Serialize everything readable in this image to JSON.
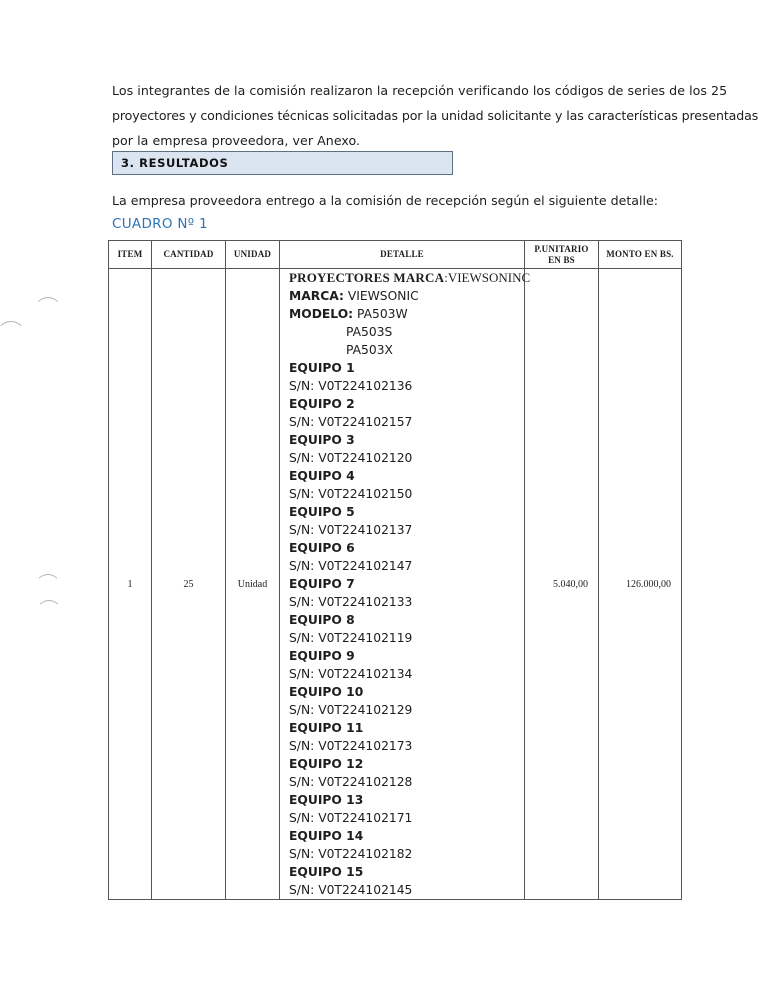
{
  "intro": {
    "line1": "Los integrantes de la comisión realizaron la recepción verificando los códigos de series de los 25",
    "line2": "proyectores  y condiciones técnicas solicitadas por la unidad solicitante y las características presentadas",
    "line3": "por la empresa proveedora, ver Anexo."
  },
  "section": {
    "heading": "3.  RESULTADOS"
  },
  "description": "La empresa proveedora entrego a la comisión de recepción según el siguiente detalle:",
  "table_title": "CUADRO Nº 1",
  "table": {
    "headers": {
      "item": "ITEM",
      "cantidad": "CANTIDAD",
      "unidad": "UNIDAD",
      "detalle": "DETALLE",
      "p_unitario_1": "P.UNITARIO",
      "p_unitario_2": "EN BS",
      "monto": "MONTO EN BS."
    },
    "row": {
      "item": "1",
      "cantidad": "25",
      "unidad": "Unidad",
      "p_unitario": "5.040,00",
      "monto": "126.000,00",
      "detalle": {
        "proyectores_label": "PROYECTORES MARCA",
        "proyectores_value": ":VIEWSONINC",
        "marca_label": "MARCA:",
        "marca_value": " VIEWSONIC",
        "modelo_label": "MODELO:",
        "modelo_value": " PA503W",
        "modelo_2": "PA503S",
        "modelo_3": "PA503X",
        "equipos": [
          {
            "label": "EQUIPO 1",
            "sn": "S/N: V0T224102136"
          },
          {
            "label": "EQUIPO 2",
            "sn": "S/N: V0T224102157"
          },
          {
            "label": "EQUIPO 3",
            "sn": "S/N: V0T224102120"
          },
          {
            "label": "EQUIPO 4",
            "sn": "S/N: V0T224102150"
          },
          {
            "label": "EQUIPO 5",
            "sn": "S/N: V0T224102137"
          },
          {
            "label": "EQUIPO 6",
            "sn": "S/N: V0T224102147"
          },
          {
            "label": "EQUIPO 7",
            "sn": "S/N: V0T224102133"
          },
          {
            "label": "EQUIPO 8",
            "sn": "S/N: V0T224102119"
          },
          {
            "label": "EQUIPO 9",
            "sn": "S/N: V0T224102134"
          },
          {
            "label": "EQUIPO 10",
            "sn": "S/N: V0T224102129"
          },
          {
            "label": "EQUIPO 11",
            "sn": "S/N: V0T224102173"
          },
          {
            "label": "EQUIPO 12",
            "sn": "S/N: V0T224102128"
          },
          {
            "label": "EQUIPO 13",
            "sn": " S/N: V0T224102171"
          },
          {
            "label": "EQUIPO 14",
            "sn": "S/N: V0T224102182"
          },
          {
            "label": "EQUIPO 15",
            "sn": "S/N: V0T224102145"
          }
        ]
      }
    }
  },
  "colors": {
    "accent": "#2e74b5",
    "section_fill": "#dbe5f1"
  }
}
